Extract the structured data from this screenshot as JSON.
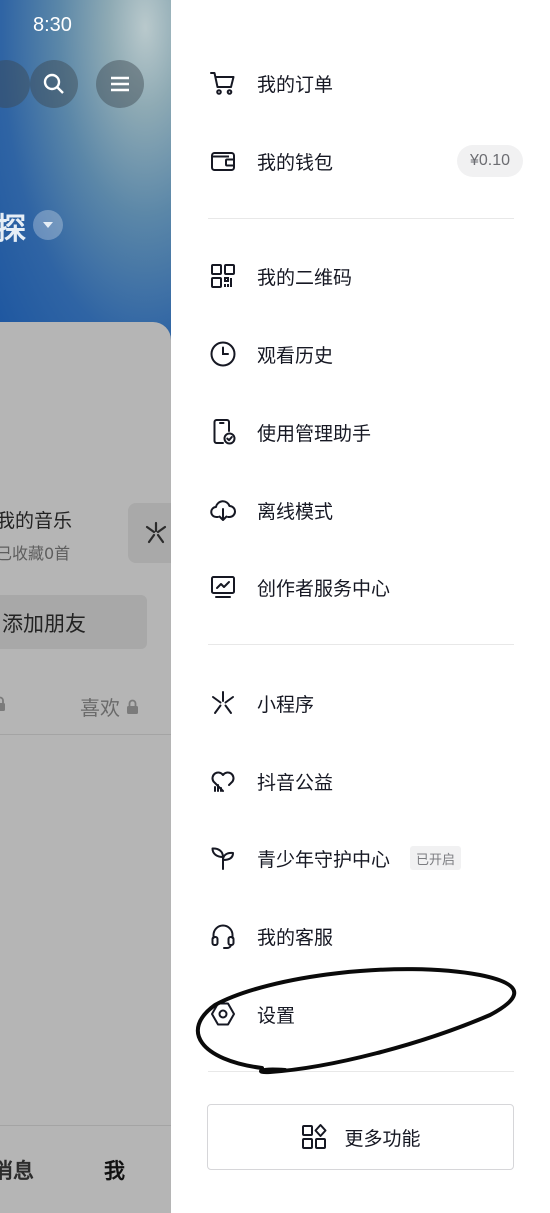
{
  "status_bar": {
    "time": "8:30"
  },
  "background": {
    "partial_name": "探",
    "music": {
      "title": "我的音乐",
      "subtitle": "已收藏0首"
    },
    "add_friend_label": "添加朋友",
    "tabs": {
      "likes": "喜欢"
    },
    "bottom_nav": {
      "messages": "消息",
      "me": "我"
    }
  },
  "drawer": {
    "group1": [
      {
        "label": "我的订单",
        "icon": "cart-icon"
      },
      {
        "label": "我的钱包",
        "icon": "wallet-icon",
        "badge": "¥0.10"
      }
    ],
    "group2": [
      {
        "label": "我的二维码",
        "icon": "qrcode-icon"
      },
      {
        "label": "观看历史",
        "icon": "clock-icon"
      },
      {
        "label": "使用管理助手",
        "icon": "phone-check-icon"
      },
      {
        "label": "离线模式",
        "icon": "cloud-download-icon"
      },
      {
        "label": "创作者服务中心",
        "icon": "creator-monitor-icon"
      }
    ],
    "group3": [
      {
        "label": "小程序",
        "icon": "mini-program-icon"
      },
      {
        "label": "抖音公益",
        "icon": "charity-heart-icon"
      },
      {
        "label": "青少年守护中心",
        "icon": "sprout-icon",
        "badge": "已开启"
      },
      {
        "label": "我的客服",
        "icon": "headset-icon"
      },
      {
        "label": "设置",
        "icon": "settings-hex-icon"
      }
    ],
    "more_label": "更多功能"
  },
  "colors": {
    "text": "#161823",
    "divider": "#e8e8e8",
    "badge_bg": "#f1f1f2",
    "overlay": "#b5b5b5"
  }
}
